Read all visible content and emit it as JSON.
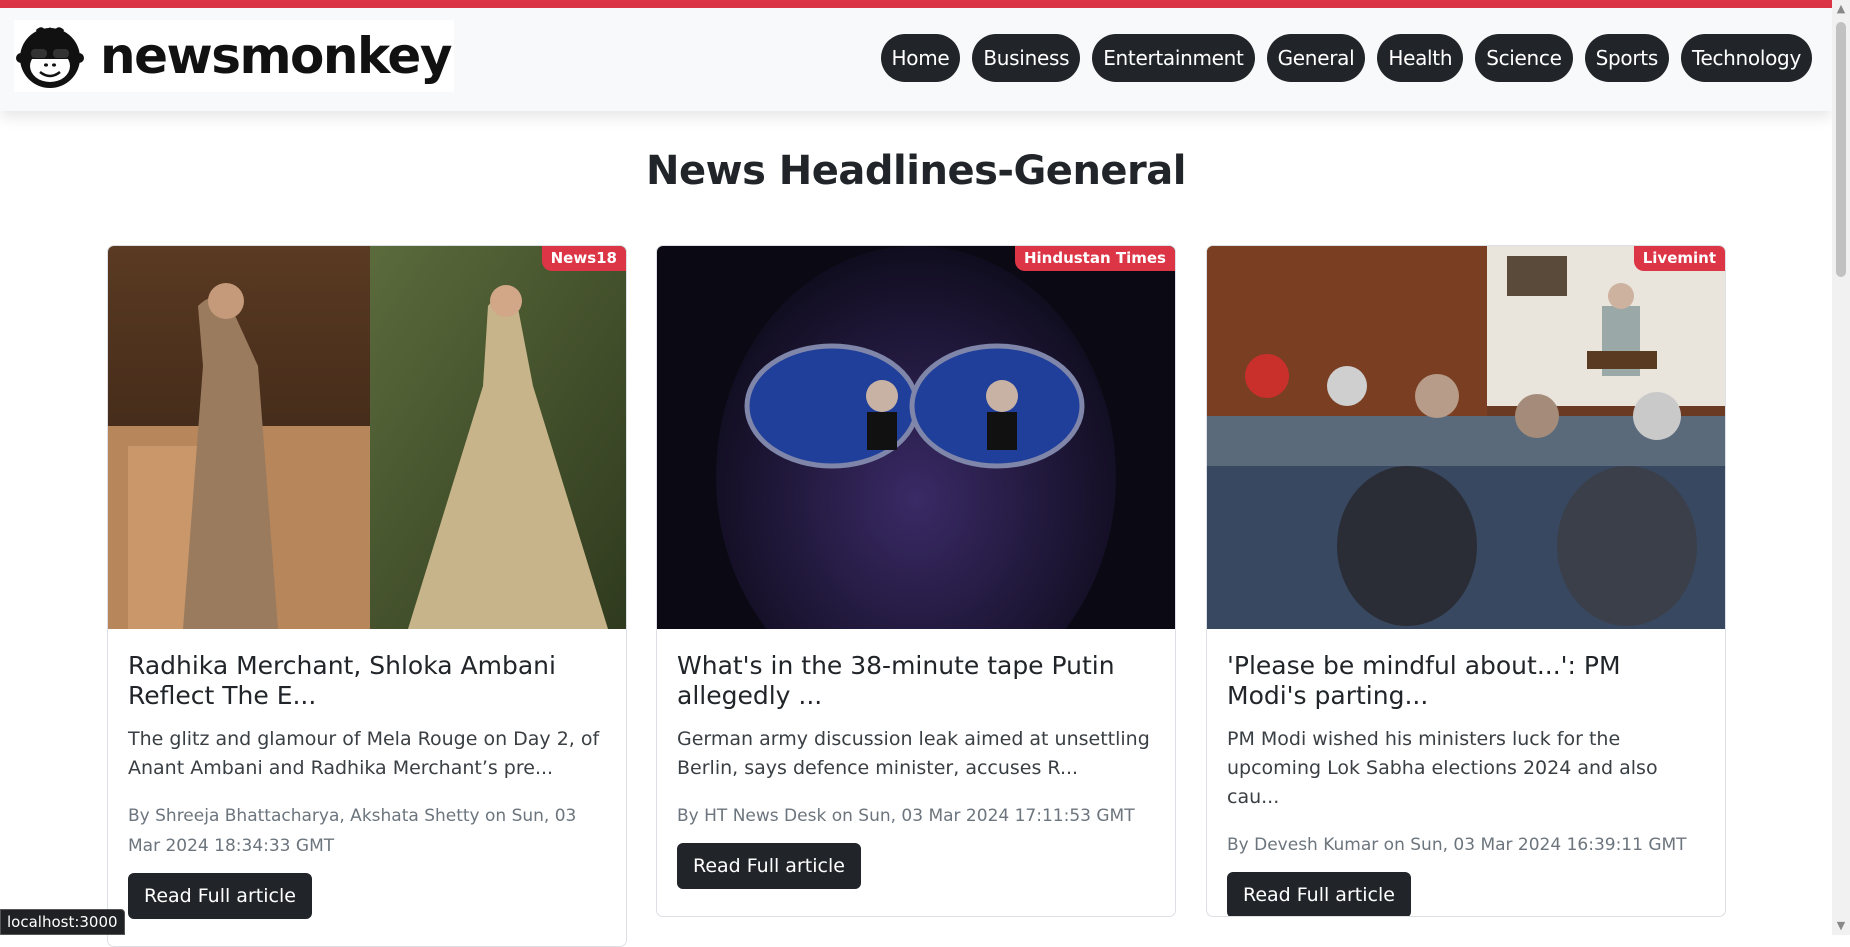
{
  "brand": {
    "name": "newsmonkey",
    "logo_icon": "monkey-icon"
  },
  "nav": {
    "items": [
      "Home",
      "Business",
      "Entertainment",
      "General",
      "Health",
      "Science",
      "Sports",
      "Technology"
    ]
  },
  "page": {
    "title": "News Headlines-General"
  },
  "articles": [
    {
      "source": "News18",
      "title": "Radhika Merchant, Shloka Ambani Reflect The E...",
      "description": "The glitz and glamour of Mela Rouge on Day 2, of Anant Ambani and Radhika Merchant’s pre...",
      "meta": "By Shreeja Bhattacharya, Akshata Shetty on Sun, 03 Mar 2024 18:34:33 GMT",
      "button": "Read Full article"
    },
    {
      "source": "Hindustan Times",
      "title": "What's in the 38-minute tape Putin allegedly ...",
      "description": "German army discussion leak aimed at unsettling Berlin, says defence minister, accuses R...",
      "meta": "By HT News Desk on Sun, 03 Mar 2024 17:11:53 GMT",
      "button": "Read Full article"
    },
    {
      "source": "Livemint",
      "title": "'Please be mindful about...': PM Modi's parting...",
      "description": "PM Modi wished his ministers luck for the upcoming Lok Sabha elections 2024 and also cau...",
      "meta": "By Devesh Kumar on Sun, 03 Mar 2024 16:39:11 GMT",
      "button": "Read Full article"
    }
  ],
  "status_bar": {
    "url": "localhost:3000"
  },
  "colors": {
    "accent": "#dc3545",
    "pill": "#212529",
    "navbar": "#f8f9fa"
  }
}
